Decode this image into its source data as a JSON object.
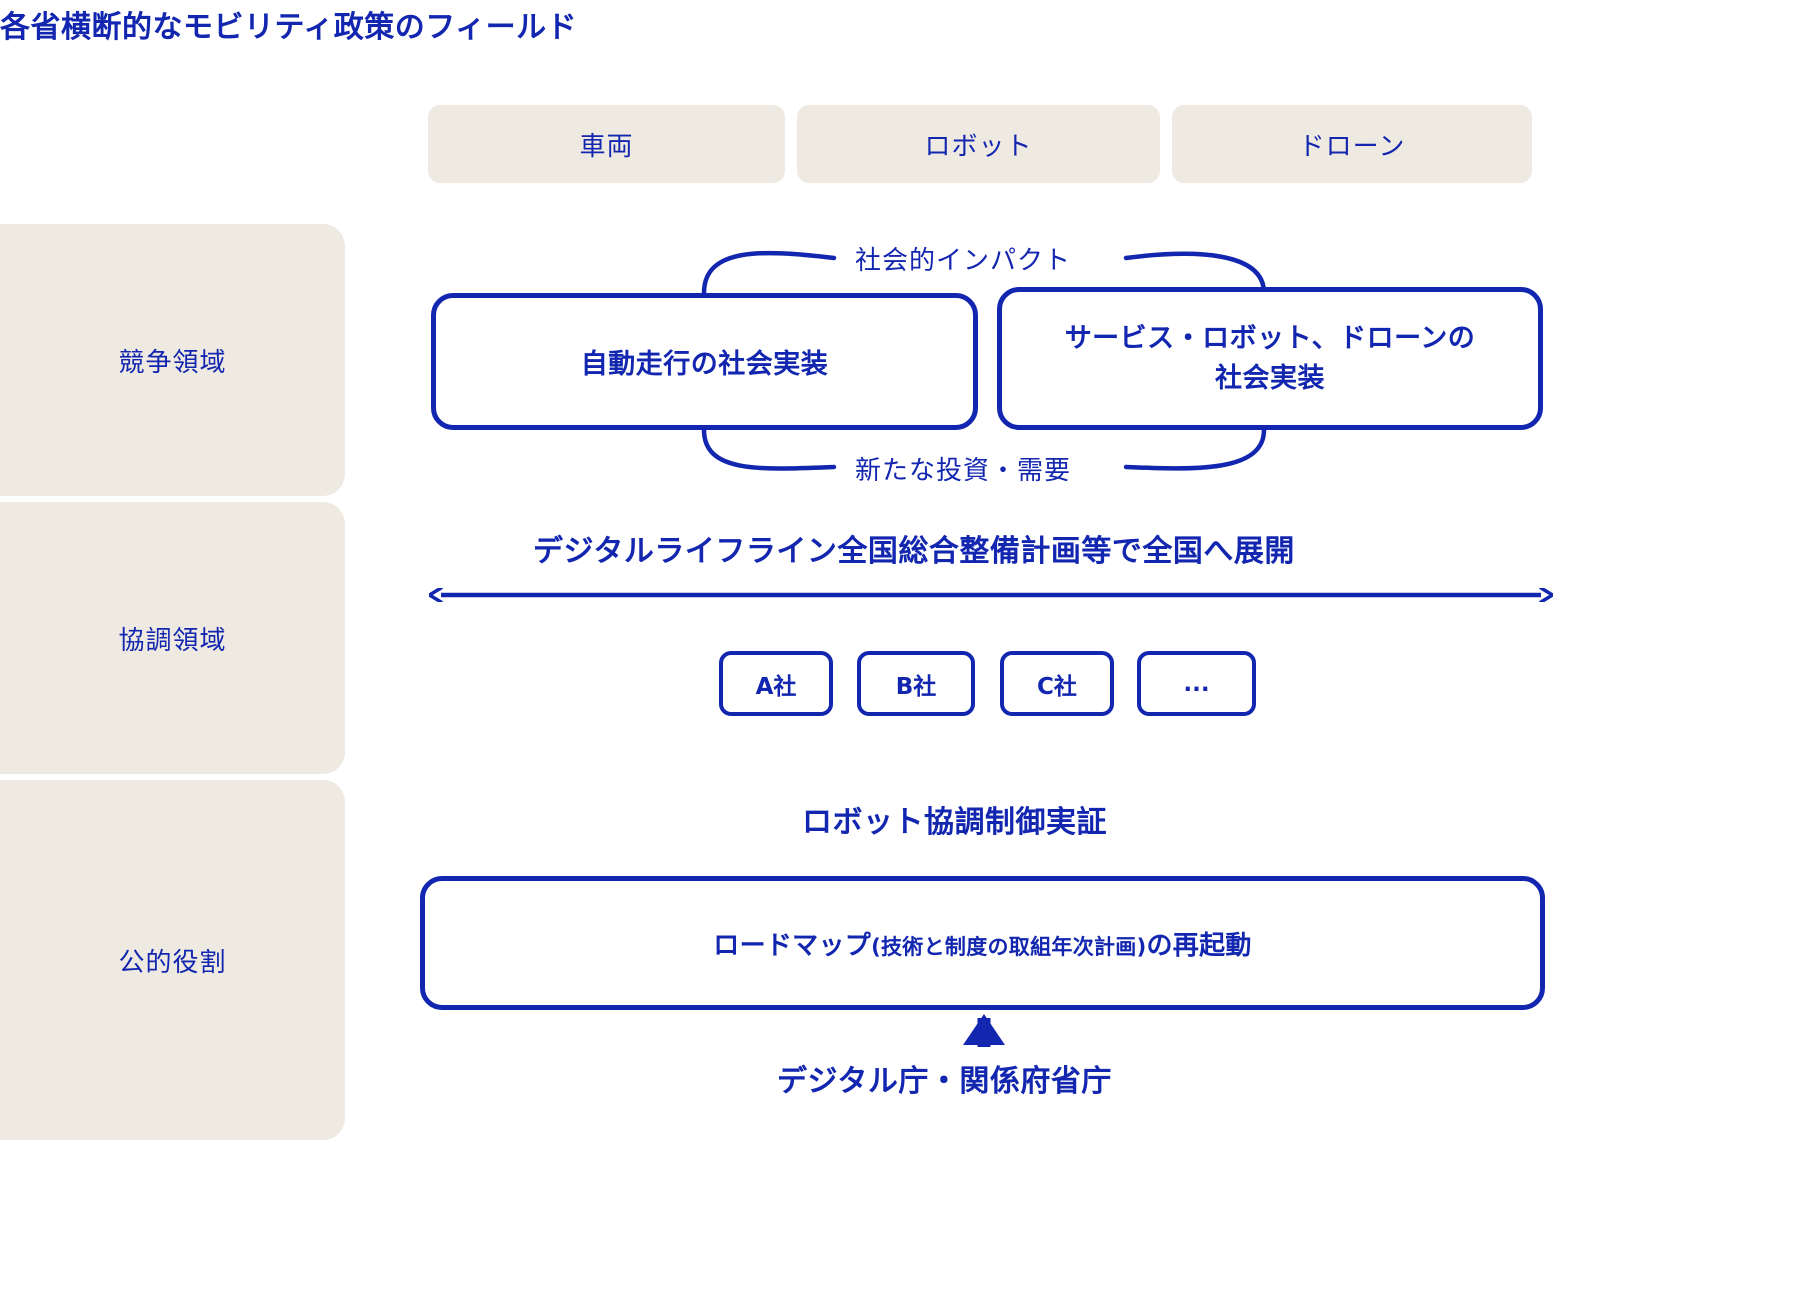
{
  "title": "各省横断的なモビリティ政策のフィールド",
  "colors": {
    "accent_blue": "#1226b0",
    "chip_beige": "#efeae1",
    "background": "#ffffff"
  },
  "column_headers": [
    {
      "label": "車両"
    },
    {
      "label": "ロボット"
    },
    {
      "label": "ドローン"
    }
  ],
  "row_labels": [
    {
      "label": "競争領域"
    },
    {
      "label": "協調領域"
    },
    {
      "label": "公的役割"
    }
  ],
  "competition": {
    "box_vehicle": "自動走行の社会実装",
    "box_service_line1": "サービス・ロボット、ドローンの",
    "box_service_line2": "社会実装",
    "arrow_top_label": "社会的インパクト",
    "arrow_bottom_label": "新たな投資・需要"
  },
  "collaboration": {
    "headline": "デジタルライフライン全国総合整備計画等で全国へ展開",
    "companies": [
      {
        "label": "A社"
      },
      {
        "label": "B社"
      },
      {
        "label": "C社"
      },
      {
        "label": "..."
      }
    ]
  },
  "public_role": {
    "headline": "ロボット協調制御実証",
    "roadmap_prefix": "ロードマップ",
    "roadmap_paren": "(技術と制度の取組年次計画)",
    "roadmap_suffix": "の再起動",
    "bottom_label": "デジタル庁・関係府省庁"
  }
}
